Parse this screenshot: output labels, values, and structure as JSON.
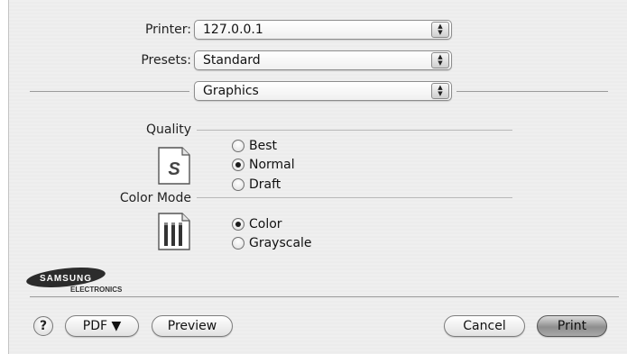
{
  "printer": {
    "label": "Printer:",
    "value": "127.0.0.1"
  },
  "presets": {
    "label": "Presets:",
    "value": "Standard"
  },
  "panel": {
    "value": "Graphics"
  },
  "quality": {
    "label": "Quality",
    "icon": "S",
    "options": [
      {
        "label": "Best",
        "checked": false
      },
      {
        "label": "Normal",
        "checked": true
      },
      {
        "label": "Draft",
        "checked": false
      }
    ]
  },
  "color_mode": {
    "label": "Color Mode",
    "options": [
      {
        "label": "Color",
        "checked": true
      },
      {
        "label": "Grayscale",
        "checked": false
      }
    ]
  },
  "brand": {
    "name": "SAMSUNG",
    "sub": "ELECTRONICS"
  },
  "buttons": {
    "help": "?",
    "pdf": "PDF ▼",
    "preview": "Preview",
    "cancel": "Cancel",
    "print": "Print"
  }
}
